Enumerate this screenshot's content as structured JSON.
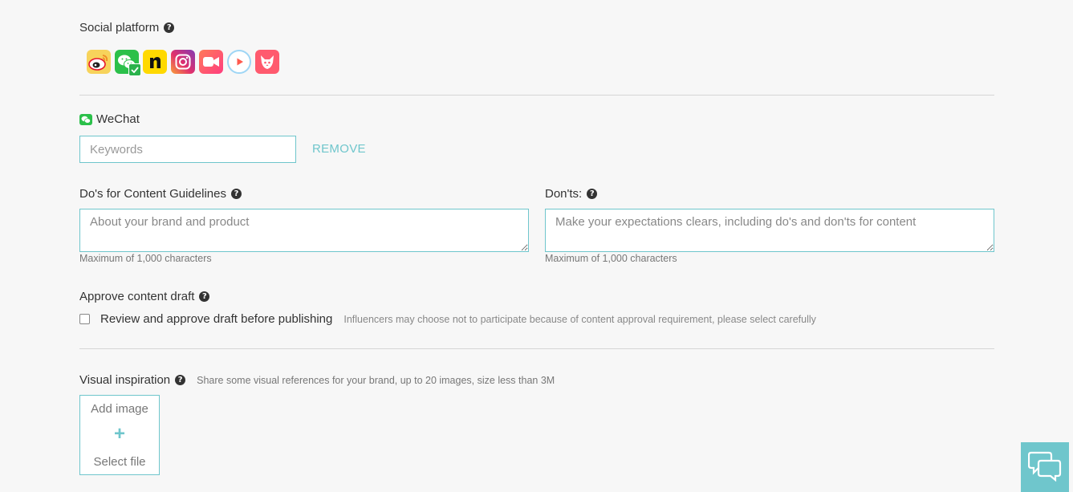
{
  "social": {
    "label": "Social platform",
    "help_icon": "question-circle-icon",
    "platforms": [
      {
        "name": "weibo",
        "icon": "weibo-icon",
        "color": "#f7d35b",
        "selected": false
      },
      {
        "name": "wechat",
        "icon": "wechat-icon",
        "color": "#2bc04a",
        "selected": true
      },
      {
        "name": "n",
        "icon": "n-app-icon",
        "color": "#ffd900",
        "selected": false
      },
      {
        "name": "instagram",
        "icon": "instagram-icon",
        "color": "#c13584",
        "selected": false
      },
      {
        "name": "video",
        "icon": "video-camera-icon",
        "color": "#ff4d6d",
        "selected": false
      },
      {
        "name": "play",
        "icon": "play-icon",
        "color": "#7ec8f0",
        "selected": false
      },
      {
        "name": "fox",
        "icon": "fox-app-icon",
        "color": "#ff5a6e",
        "selected": false
      }
    ]
  },
  "wechat": {
    "label": "WeChat",
    "keywords_placeholder": "Keywords",
    "keywords_value": "",
    "remove_label": "REMOVE"
  },
  "dos": {
    "label": "Do's for Content Guidelines",
    "placeholder": "About your brand and product",
    "hint": "Maximum of 1,000 characters"
  },
  "donts": {
    "label": "Don'ts:",
    "placeholder": "Make your expectations clears, including do's and don'ts for content",
    "hint": "Maximum of 1,000 characters"
  },
  "approve": {
    "label": "Approve content draft",
    "checkbox_label": "Review and approve draft before publishing",
    "checked": false,
    "note": "Influencers may choose not to participate because of content approval requirement, please select carefully"
  },
  "visual": {
    "label": "Visual inspiration",
    "note": "Share some visual references for your brand, up to 20 images, size less than 3M",
    "upload_title": "Add image",
    "upload_plus": "+",
    "upload_file": "Select file"
  },
  "chat_widget": {
    "icon": "chat-bubbles-icon",
    "color": "#6fc6cc"
  }
}
